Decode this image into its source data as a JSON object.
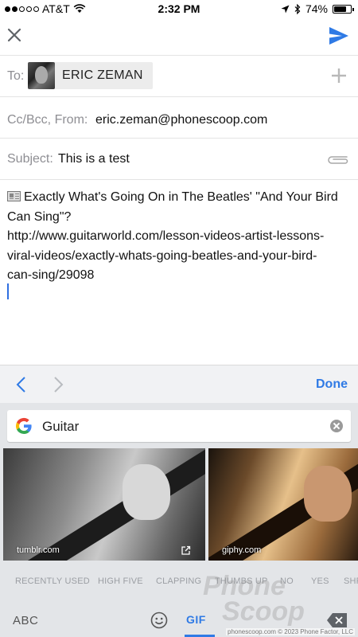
{
  "statusbar": {
    "carrier": "AT&T",
    "time": "2:32 PM",
    "battery": "74%",
    "battery_level": 0.74,
    "signal_bars_filled": 2,
    "signal_bars_total": 5
  },
  "compose": {
    "to_label": "To:",
    "recipient_name": "ERIC ZEMAN",
    "cc_label": "Cc/Bcc, From:",
    "from_value": "eric.zeman@phonescoop.com",
    "subject_label": "Subject:",
    "subject_value": "This is a test",
    "body_lines": [
      "Exactly What's Going On in The Beatles' \"And Your Bird",
      "Can Sing\"?",
      "http://www.guitarworld.com/lesson-videos-artist-lessons-",
      "viral-videos/exactly-whats-going-beatles-and-your-bird-",
      "can-sing/29098"
    ]
  },
  "keyboard_nav": {
    "done_label": "Done"
  },
  "gboard": {
    "search_value": "Guitar",
    "results": [
      {
        "source": "tumblr.com"
      },
      {
        "source": "giphy.com"
      }
    ],
    "categories": [
      "RECENTLY USED",
      "HIGH FIVE",
      "CLAPPING",
      "THUMBS UP",
      "NO",
      "YES",
      "SHR"
    ],
    "abc_label": "ABC",
    "gif_label": "GIF"
  },
  "watermark": {
    "line1": "Phone",
    "line2": "Scoop",
    "footer": "phonescoop.com  © 2023 Phone Factor, LLC"
  },
  "colors": {
    "accent": "#2f7ae5",
    "keyboard_bg": "#e3e5e8",
    "nav_bg": "#f1f2f4",
    "label_gray": "#8e8e93"
  }
}
